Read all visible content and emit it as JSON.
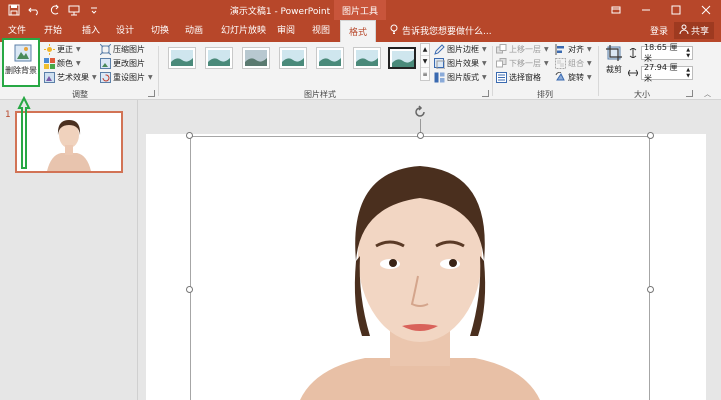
{
  "window": {
    "title": "演示文稿1 - PowerPoint",
    "contextual_tab": "图片工具"
  },
  "tabs": [
    {
      "label": "文件"
    },
    {
      "label": "开始"
    },
    {
      "label": "插入"
    },
    {
      "label": "设计"
    },
    {
      "label": "切换"
    },
    {
      "label": "动画"
    },
    {
      "label": "幻灯片放映"
    },
    {
      "label": "审阅"
    },
    {
      "label": "视图"
    },
    {
      "label": "格式",
      "active": true
    }
  ],
  "tell_me": "告诉我您想要做什么...",
  "account": {
    "login": "登录",
    "share": "共享"
  },
  "ribbon": {
    "adjust": {
      "remove_background": "删除背景",
      "corrections": "更正",
      "color": "颜色",
      "artistic_effects": "艺术效果",
      "compress": "压缩图片",
      "change_picture": "更改图片",
      "reset_picture": "重设图片",
      "group_label": "调整"
    },
    "styles": {
      "border": "图片边框",
      "effects": "图片效果",
      "layout": "图片版式",
      "group_label": "图片样式"
    },
    "arrange": {
      "bring_forward": "上移一层",
      "send_backward": "下移一层",
      "selection_pane": "选择窗格",
      "align": "对齐",
      "group": "组合",
      "rotate": "旋转",
      "group_label": "排列"
    },
    "size": {
      "crop": "裁剪",
      "height": "18.65 厘米",
      "width": "27.94 厘米",
      "group_label": "大小"
    }
  },
  "slides": {
    "current_number": "1"
  },
  "colors": {
    "accent": "#b7472a",
    "highlight": "#27a844"
  }
}
